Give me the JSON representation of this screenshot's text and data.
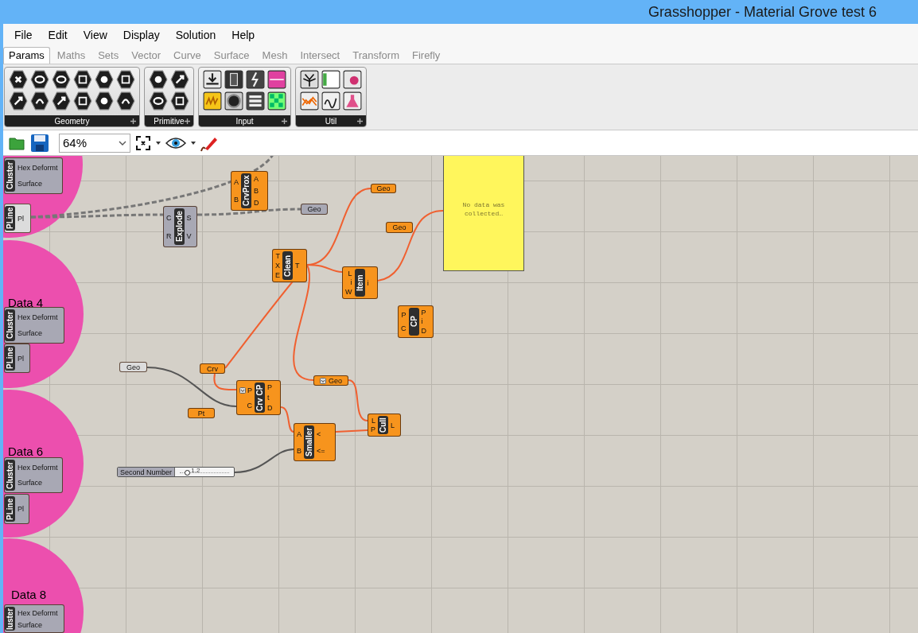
{
  "window": {
    "title": "Grasshopper - Material Grove test 6"
  },
  "menu": [
    "File",
    "Edit",
    "View",
    "Display",
    "Solution",
    "Help"
  ],
  "tabs": [
    {
      "label": "Params",
      "selected": true
    },
    {
      "label": "Maths",
      "selected": false
    },
    {
      "label": "Sets",
      "selected": false
    },
    {
      "label": "Vector",
      "selected": false
    },
    {
      "label": "Curve",
      "selected": false
    },
    {
      "label": "Surface",
      "selected": false
    },
    {
      "label": "Mesh",
      "selected": false
    },
    {
      "label": "Intersect",
      "selected": false
    },
    {
      "label": "Transform",
      "selected": false
    },
    {
      "label": "Firefly",
      "selected": false
    }
  ],
  "ribbon": {
    "groups": [
      {
        "label": "Geometry"
      },
      {
        "label": "Primitive"
      },
      {
        "label": "Input"
      },
      {
        "label": "Util"
      }
    ]
  },
  "toolbar": {
    "zoom": "64%"
  },
  "canvas": {
    "groups": [
      {
        "kind": "group"
      },
      {
        "kind": "group",
        "label": "Data 4"
      },
      {
        "kind": "group",
        "label": "Data 6"
      },
      {
        "kind": "group",
        "label": "Data 8"
      }
    ],
    "nodes": [
      {
        "kind": "cluster",
        "name": "Cluster",
        "color": "#a8a8b4",
        "outputs": [
          "Hex Deformt",
          "Surface"
        ]
      },
      {
        "kind": "cluster",
        "name": "PLine",
        "color": "#dcdcdc",
        "outputs": [
          "Pl"
        ]
      },
      {
        "kind": "component",
        "name": "CrvProx",
        "color": "#f7941d",
        "inputs": [
          "A",
          "B"
        ],
        "outputs": [
          "A",
          "B",
          "D"
        ]
      },
      {
        "kind": "component",
        "name": "Explode",
        "color": "#a8a8b4",
        "inputs": [
          "C",
          "R"
        ],
        "outputs": [
          "S",
          "V"
        ]
      },
      {
        "kind": "param",
        "name": "Geo",
        "color": "#a8a8b4"
      },
      {
        "kind": "param",
        "name": "Geo",
        "color": "#f7941d"
      },
      {
        "kind": "param",
        "name": "Geo",
        "color": "#f7941d"
      },
      {
        "kind": "panel",
        "text": "No data was collected…"
      },
      {
        "kind": "component",
        "name": "Clean",
        "color": "#f7941d",
        "inputs": [
          "T",
          "X",
          "E"
        ],
        "outputs": [
          "T"
        ]
      },
      {
        "kind": "component",
        "name": "Item",
        "color": "#f7941d",
        "inputs": [
          "L",
          "i",
          "W"
        ],
        "outputs": [
          "i"
        ]
      },
      {
        "kind": "cluster",
        "name": "Cluster",
        "color": "#a8a8b4",
        "outputs": [
          "Hex Deformt",
          "Surface"
        ]
      },
      {
        "kind": "component",
        "name": "CP",
        "color": "#f7941d",
        "inputs": [
          "P",
          "C"
        ],
        "outputs": [
          "P",
          "i",
          "D"
        ]
      },
      {
        "kind": "cluster",
        "name": "PLine",
        "color": "#a8a8b4",
        "outputs": [
          "Pl"
        ]
      },
      {
        "kind": "param",
        "name": "Geo",
        "color": "#dcdcdc"
      },
      {
        "kind": "param",
        "name": "Crv",
        "color": "#f7941d"
      },
      {
        "kind": "param",
        "name": "Geo",
        "color": "#f7941d",
        "flatten": true
      },
      {
        "kind": "component",
        "name": "Crv CP",
        "color": "#f7941d",
        "inputs": [
          "P",
          "C"
        ],
        "outputs": [
          "P",
          "t",
          "D"
        ],
        "flatten": true
      },
      {
        "kind": "param",
        "name": "Pt",
        "color": "#f7941d"
      },
      {
        "kind": "component",
        "name": "Cull",
        "color": "#f7941d",
        "inputs": [
          "L",
          "P"
        ],
        "outputs": [
          "L"
        ]
      },
      {
        "kind": "component",
        "name": "Smaller",
        "color": "#f7941d",
        "inputs": [
          "A",
          "B"
        ],
        "outputs": [
          "<",
          "<="
        ]
      },
      {
        "kind": "cluster",
        "name": "Cluster",
        "color": "#a8a8b4",
        "outputs": [
          "Hex Deformt",
          "Surface"
        ]
      },
      {
        "kind": "slider",
        "name": "Second Number",
        "value": "1.2",
        "level": 0.15
      },
      {
        "kind": "cluster",
        "name": "PLine",
        "color": "#a8a8b4",
        "outputs": [
          "Pl"
        ]
      },
      {
        "kind": "cluster",
        "name": "luster",
        "color": "#a8a8b4",
        "outputs": [
          "Hex Deformt",
          "Surface"
        ]
      }
    ]
  }
}
